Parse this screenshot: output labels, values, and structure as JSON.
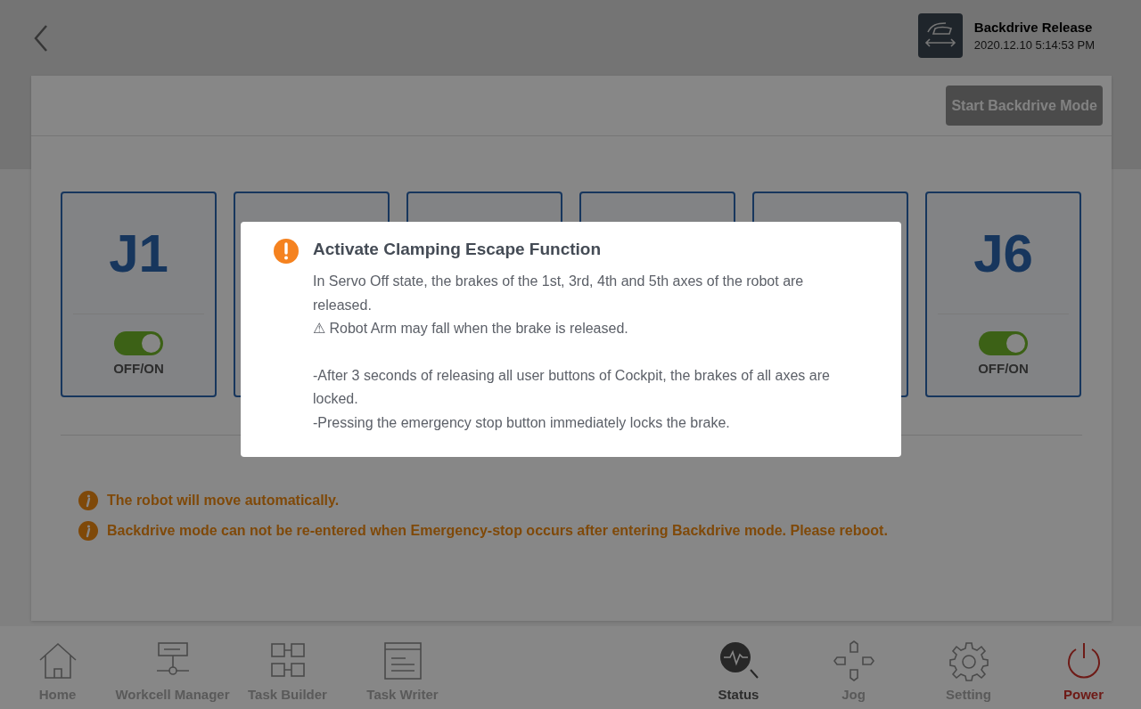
{
  "header": {
    "title": "Backdrive Release",
    "timestamp": "2020.12.10 5:14:53 PM"
  },
  "panel": {
    "start_button": {
      "label": "Start Backdrive Mode",
      "disabled": true
    },
    "joints": [
      {
        "kind": "joint",
        "label": "J1",
        "on": true,
        "switch_label": "OFF/ON"
      },
      {
        "kind": "covered"
      },
      {
        "kind": "covered"
      },
      {
        "kind": "covered"
      },
      {
        "kind": "covered"
      },
      {
        "kind": "joint",
        "label": "J6",
        "on": true,
        "switch_label": "OFF/ON"
      }
    ],
    "warnings": [
      "The robot will move automatically.",
      "Backdrive mode can not be re-entered when Emergency-stop occurs after entering Backdrive mode. Please reboot."
    ]
  },
  "nav": {
    "left": [
      {
        "label": "Home",
        "selected": false,
        "kind": "nav"
      },
      {
        "label": "Workcell Manager",
        "selected": false,
        "kind": "nav"
      },
      {
        "label": "Task Builder",
        "selected": false,
        "kind": "nav"
      },
      {
        "label": "Task Writer",
        "selected": false,
        "kind": "nav"
      }
    ],
    "right": [
      {
        "label": "Status",
        "selected": true,
        "kind": "nav"
      },
      {
        "label": "Jog",
        "selected": false,
        "kind": "nav"
      },
      {
        "label": "Setting",
        "selected": false,
        "kind": "nav"
      },
      {
        "label": "Power",
        "selected": false,
        "kind": "power"
      }
    ]
  },
  "dialog": {
    "title": "Activate Clamping Escape Function",
    "paragraphs": [
      [
        "In Servo Off state, the brakes of the 1st, 3rd, 4th and 5th axes of the robot are released.",
        "⚠ Robot Arm may fall when the brake is released."
      ],
      [
        "-After 3 seconds of releasing all user buttons of Cockpit, the brakes of all axes are locked.",
        "-Pressing the emergency stop button immediately locks the brake."
      ]
    ]
  }
}
